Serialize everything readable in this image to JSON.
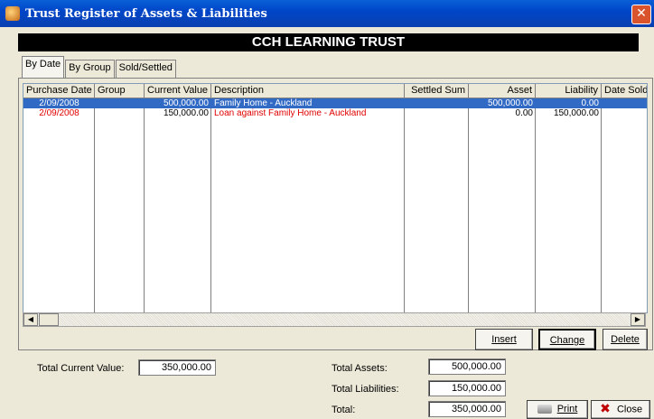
{
  "window": {
    "title": "Trust Register of Assets & Liabilities",
    "close_glyph": "✕"
  },
  "banner": "CCH LEARNING TRUST",
  "tabs": [
    "By Date",
    "By Group",
    "Sold/Settled"
  ],
  "grid": {
    "columns": [
      "Purchase Date",
      "Group",
      "Current Value",
      "Description",
      "Settled Sum",
      "Asset",
      "Liability",
      "Date Sold"
    ],
    "rows": [
      {
        "purchase_date": "2/09/2008",
        "group": "",
        "current_value": "500,000.00",
        "description": "Family Home - Auckland",
        "settled_sum": "",
        "asset": "500,000.00",
        "liability": "0.00",
        "date_sold": "",
        "selected": true
      },
      {
        "purchase_date": "2/09/2008",
        "group": "",
        "current_value": "150,000.00",
        "description": "Loan against Family Home - Auckland",
        "settled_sum": "",
        "asset": "0.00",
        "liability": "150,000.00",
        "date_sold": "",
        "selected": false
      }
    ]
  },
  "scroll": {
    "left_glyph": "◀",
    "right_glyph": "▶"
  },
  "buttons": {
    "insert": "Insert",
    "change": "Change",
    "delete": "Delete",
    "print": "Print",
    "close": "Close"
  },
  "totals": {
    "current_value_label": "Total Current Value:",
    "current_value": "350,000.00",
    "assets_label": "Total Assets:",
    "assets": "500,000.00",
    "liabilities_label": "Total Liabilities:",
    "liabilities": "150,000.00",
    "total_label": "Total:",
    "total": "350,000.00"
  },
  "colors": {
    "title_bar": "#0046c8",
    "selection": "#316ac5",
    "negative_row_text": "#e00000",
    "dialog_bg": "#ece9d8"
  }
}
